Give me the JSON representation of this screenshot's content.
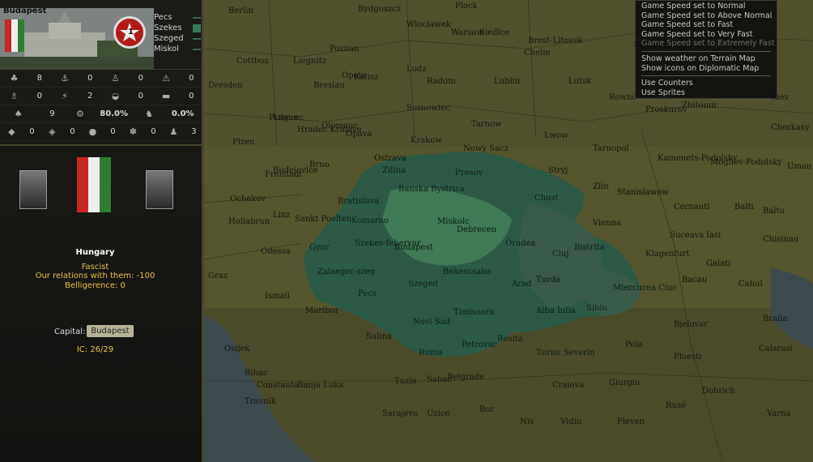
{
  "province": {
    "name": "Budapest",
    "victory_points": "1",
    "neighbors": [
      "Pecs",
      "Szekes",
      "Szeged",
      "Miskol"
    ]
  },
  "stats": [
    [
      {
        "icon": "infantry-icon",
        "value": "8"
      },
      {
        "icon": "anchor-icon",
        "value": "0"
      },
      {
        "icon": "bell-icon",
        "value": "0"
      },
      {
        "icon": "anti-air-icon",
        "value": "0"
      }
    ],
    [
      {
        "icon": "flask-icon",
        "value": "0"
      },
      {
        "icon": "bolt-icon",
        "value": "2"
      },
      {
        "icon": "car-icon",
        "value": "0"
      },
      {
        "icon": "truck-icon",
        "value": "0"
      }
    ],
    [
      {
        "icon": "factory-icon",
        "value": "9"
      },
      {
        "icon": "gears-icon",
        "value": "80.0%"
      },
      {
        "icon": "soldier-icon",
        "value": "0.0%"
      }
    ]
  ],
  "resources": [
    {
      "icon": "energy-icon",
      "value": "0"
    },
    {
      "icon": "metal-icon",
      "value": "0"
    },
    {
      "icon": "oil-icon",
      "value": "0"
    },
    {
      "icon": "rare-materials-icon",
      "value": "0"
    },
    {
      "icon": "manpower-icon",
      "value": "3"
    }
  ],
  "country": {
    "name": "Hungary",
    "ideology": "Fascist",
    "relations": "Our relations with them: -100",
    "belligerence": "Belligerence: 0",
    "capital_label": "Capital:",
    "capital": "Budapest",
    "ic": "IC: 26/29"
  },
  "menu": {
    "items": [
      {
        "label": "Game Speed set to Normal",
        "enabled": true
      },
      {
        "label": "Game Speed set to Above Normal",
        "enabled": true
      },
      {
        "label": "Game Speed set to Fast",
        "enabled": true
      },
      {
        "label": "Game Speed set to Very Fast",
        "enabled": true
      },
      {
        "label": "Game Speed set to Extremely Fast",
        "enabled": false
      }
    ],
    "map_items": [
      {
        "label": "Show weather on Terrain Map"
      },
      {
        "label": "Show icons on Diplomatic Map"
      }
    ],
    "unit_items": [
      {
        "label": "Use Counters"
      },
      {
        "label": "Use Sprites"
      }
    ]
  },
  "map": {
    "outer_labels": [
      "Berlin",
      "Plock",
      "Bydgoszcz",
      "Wloclawek",
      "Warsaw",
      "Siedlce",
      "Brest-Litovsk",
      "Sarny",
      "Cottbus",
      "Liegnitz",
      "Poznan",
      "Lodz",
      "Kalisz",
      "Radom",
      "Lublin",
      "Chelm",
      "Lutsk",
      "Rowno",
      "Zhitomir",
      "Kiev",
      "Dresden",
      "Breslau",
      "Opole",
      "Sosnowiec",
      "Tarnow",
      "Lwow",
      "Tarnopol",
      "Proskurov",
      "Cherkasy",
      "Plzen",
      "Liberec",
      "Prague",
      "Hradec Kralove",
      "Olomouc",
      "Opava",
      "Ostrava",
      "Krakow",
      "Nowy Sacz",
      "Stryj",
      "Kamenets-Podolsky",
      "Uman",
      "Mogilev-Podolsky",
      "Brno",
      "Budejovice",
      "Zlin",
      "Stanislawow",
      "Cernauti",
      "Balti",
      "Baltu",
      "Ochakov",
      "Freistadt",
      "Hollabrun",
      "Linz",
      "Sankt Poelten",
      "Vienna",
      "Suceava",
      "Iasi",
      "Chisinau",
      "Odessa",
      "Graz",
      "Klagenfurt",
      "Bacau",
      "Galati",
      "Cahul",
      "Ismail",
      "Maribor",
      "Bjelovar",
      "Braila",
      "Sulina",
      "Osijek",
      "Pola",
      "Ploesti",
      "Calarasi",
      "Constanta",
      "Bihac",
      "Banja Luka",
      "Tuzla",
      "Sabac",
      "Craiova",
      "Giurgiu",
      "Rusé",
      "Dobrich",
      "Travnik",
      "Sarajevo",
      "Uzice",
      "Bor",
      "Nis",
      "Vidin",
      "Pleven",
      "Varna",
      "Belgrade"
    ],
    "hungary_labels": [
      "Zilina",
      "Presov",
      "Bratislava",
      "Banska Bystrica",
      "Chust",
      "Komarno",
      "Miskolc",
      "Gyor",
      "Debrecen",
      "Oradea",
      "Szekes-fehervar",
      "Budapest",
      "Bistrita",
      "Cluj",
      "Zalaeger-szeg",
      "Bekescsaba",
      "Arad",
      "Turda",
      "Miercurea Ciuc",
      "Pecs",
      "Szeged",
      "Alba Iulia",
      "Sibiu",
      "Novi Sad",
      "Timisoara",
      "Ruma",
      "Petrovac",
      "Resita",
      "Turnu Severin"
    ]
  },
  "colors": {
    "hungary": "#2e6b4f",
    "occupied": "#3c5a4c",
    "terrain": "#5a5a36",
    "ideology": "#e8c24a"
  }
}
